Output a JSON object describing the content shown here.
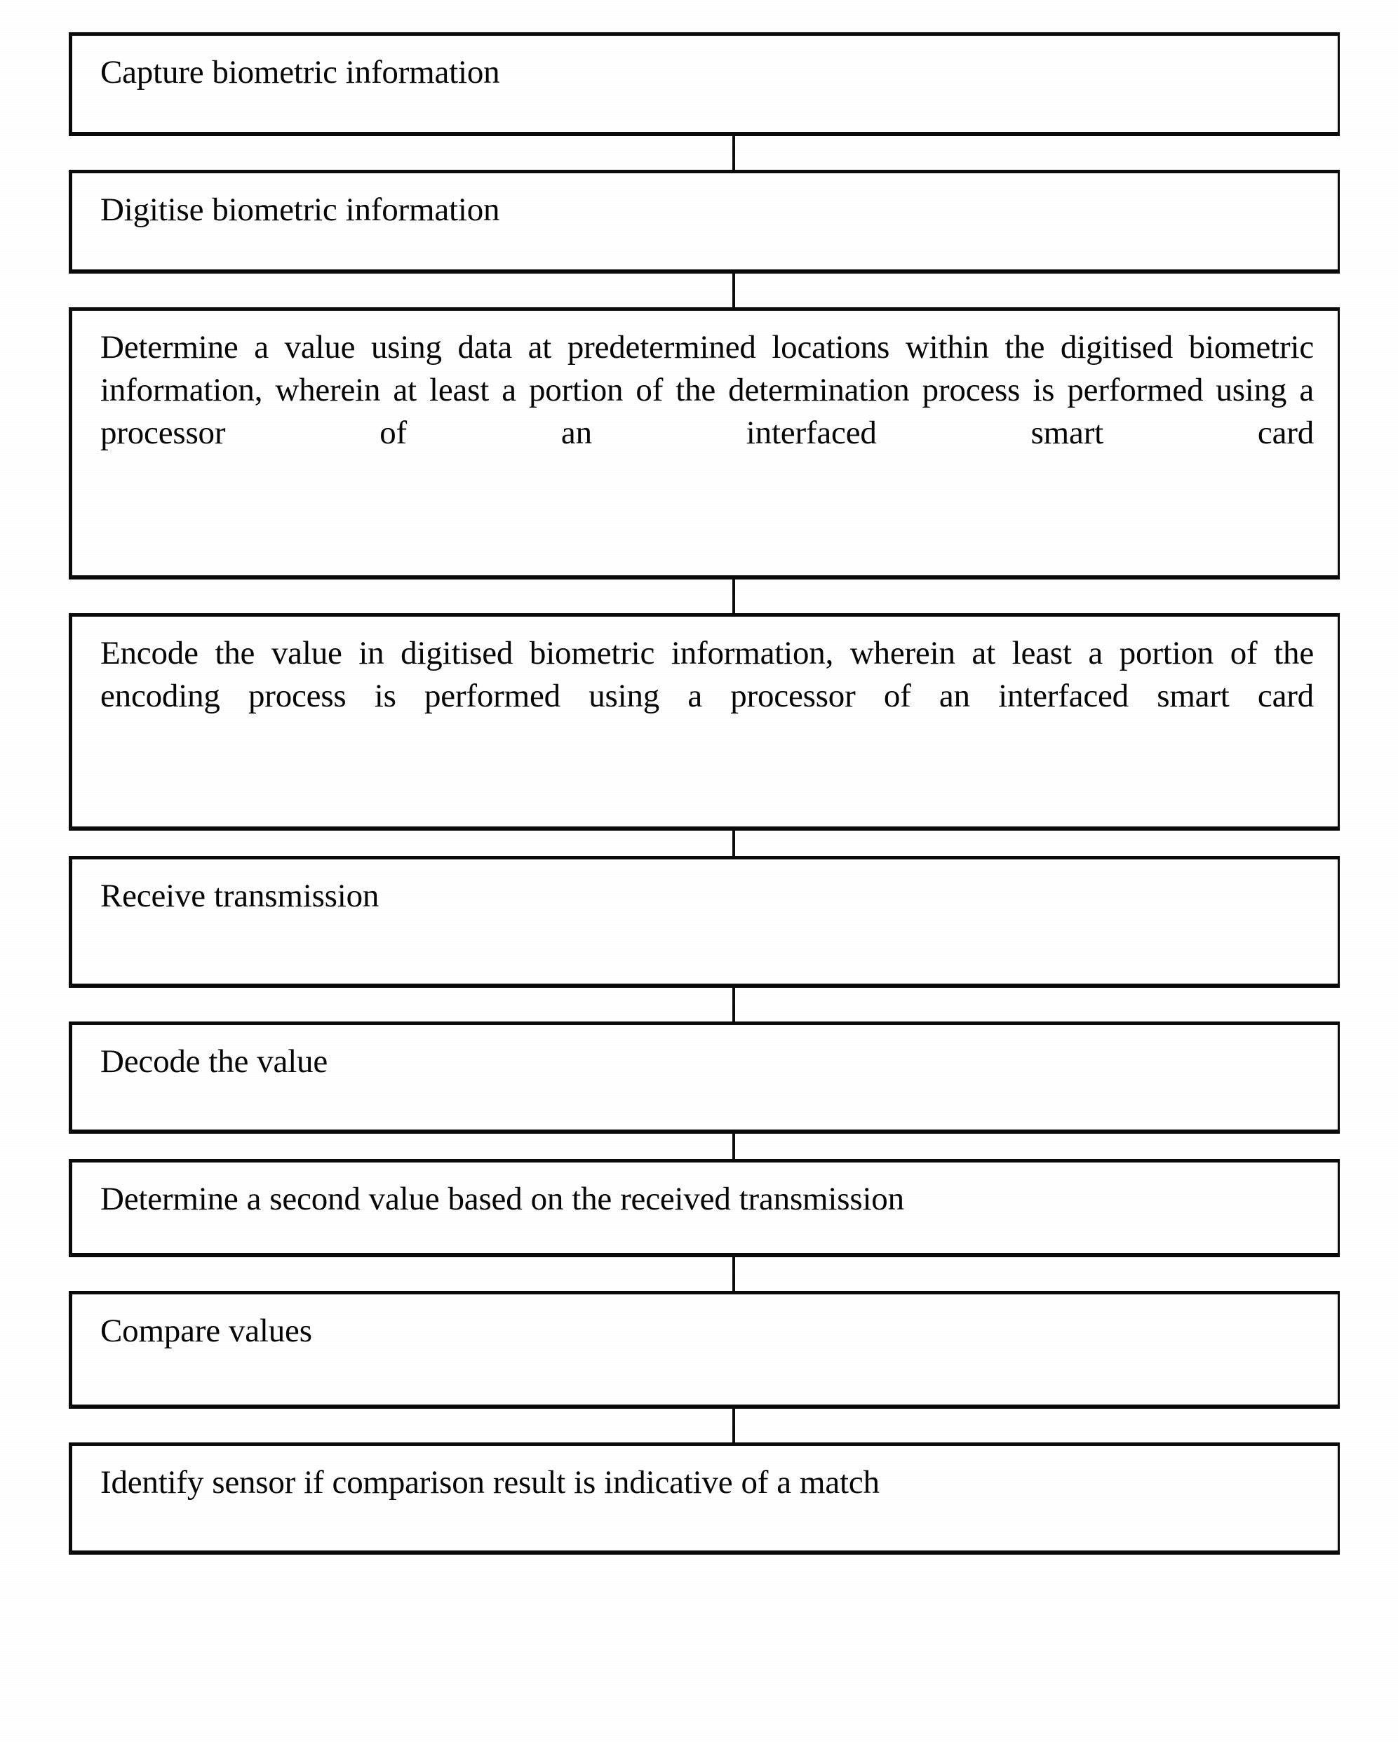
{
  "figure": {
    "type": "flowchart",
    "orientation": "vertical",
    "description": "Patent flowchart of a biometric authentication method using a smart card processor",
    "border_color": "#0a0a0a",
    "background_color": "#ffffff",
    "text_color": "#060606"
  },
  "steps": [
    {
      "index": 1,
      "id": "capture-biometric-information",
      "text": "Capture biometric information"
    },
    {
      "index": 2,
      "id": "digitise-biometric-information",
      "text": "Digitise biometric information"
    },
    {
      "index": 3,
      "id": "determine-a-value",
      "text": "Determine a value using data at predetermined locations within the digitised biometric information, wherein at least a portion of the determination process is performed using a processor of an interfaced smart card"
    },
    {
      "index": 4,
      "id": "encode-the-value",
      "text": "Encode the value in digitised biometric information, wherein at least a portion of the encoding process is performed using a processor of an interfaced smart card"
    },
    {
      "index": 5,
      "id": "receive-transmission",
      "text": "Receive transmission"
    },
    {
      "index": 6,
      "id": "decode-the-value",
      "text": "Decode the value"
    },
    {
      "index": 7,
      "id": "determine-a-second-value",
      "text": "Determine a second value based on the received transmission"
    },
    {
      "index": 8,
      "id": "compare-values",
      "text": "Compare values"
    },
    {
      "index": 9,
      "id": "identify-sensor",
      "text": "Identify sensor if comparison result is indicative of a match"
    }
  ],
  "connectors": [
    {
      "from": 1,
      "to": 2
    },
    {
      "from": 2,
      "to": 3
    },
    {
      "from": 3,
      "to": 4
    },
    {
      "from": 4,
      "to": 5
    },
    {
      "from": 5,
      "to": 6
    },
    {
      "from": 6,
      "to": 7
    },
    {
      "from": 7,
      "to": 8
    },
    {
      "from": 8,
      "to": 9
    }
  ]
}
